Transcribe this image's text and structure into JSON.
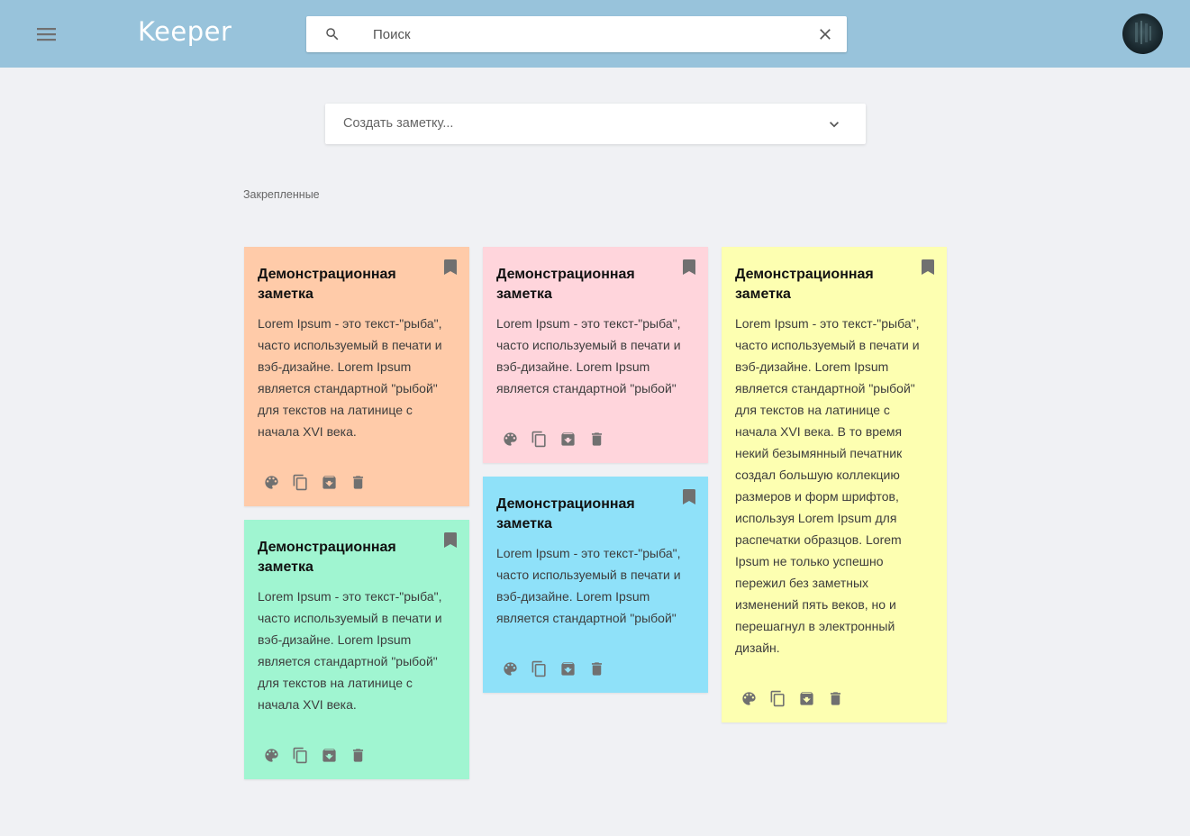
{
  "header": {
    "logo": "Keeper",
    "search": {
      "placeholder": "Поиск",
      "value": ""
    }
  },
  "create_note": {
    "placeholder": "Создать заметку..."
  },
  "section": {
    "pinned_label": "Закрепленные"
  },
  "colors": {
    "header_bg": "#98c3db",
    "page_bg": "#f0f1f4",
    "note_orange": "#ffcba9",
    "note_pink": "#ffd5dc",
    "note_green": "#a0f5d1",
    "note_blue": "#8fe1f9",
    "note_yellow": "#fdffb1",
    "icon_gray": "#707070"
  },
  "icons": {
    "menu": "hamburger-menu-icon",
    "search": "search-icon",
    "clear": "close-icon",
    "expand": "chevron-down-icon",
    "pin": "bookmark-icon",
    "palette": "palette-icon",
    "copy": "copy-icon",
    "archive": "archive-icon",
    "delete": "trash-icon"
  },
  "notes": [
    {
      "title": "Демонстрационная заметка",
      "body": "Lorem Ipsum - это текст-\"рыба\", часто используемый в печати и вэб-дизайне. Lorem Ipsum является стандартной \"рыбой\" для текстов на латинице с начала XVI века.",
      "color": "#ffcba9"
    },
    {
      "title": "Демонстрационная заметка",
      "body": "Lorem Ipsum - это текст-\"рыба\", часто используемый в печати и вэб-дизайне. Lorem Ipsum является стандартной \"рыбой\" для текстов на латинице с начала XVI века.",
      "color": "#a0f5d1"
    },
    {
      "title": "Демонстрационная заметка",
      "body": "Lorem Ipsum - это текст-\"рыба\", часто используемый в печати и вэб-дизайне. Lorem Ipsum является стандартной \"рыбой\"",
      "color": "#ffd5dc"
    },
    {
      "title": "Демонстрационная заметка",
      "body": "Lorem Ipsum - это текст-\"рыба\", часто используемый в печати и вэб-дизайне. Lorem Ipsum является стандартной \"рыбой\"",
      "color": "#8fe1f9"
    },
    {
      "title": "Демонстрационная заметка",
      "body": "Lorem Ipsum - это текст-\"рыба\", часто используемый в печати и вэб-дизайне. Lorem Ipsum является стандартной \"рыбой\" для текстов на латинице с начала XVI века. В то время некий безымянный печатник создал большую коллекцию размеров и форм шрифтов, используя Lorem Ipsum для распечатки образцов. Lorem Ipsum не только успешно пережил без заметных изменений пять веков, но и перешагнул в электронный дизайн.",
      "color": "#fdffb1"
    }
  ]
}
